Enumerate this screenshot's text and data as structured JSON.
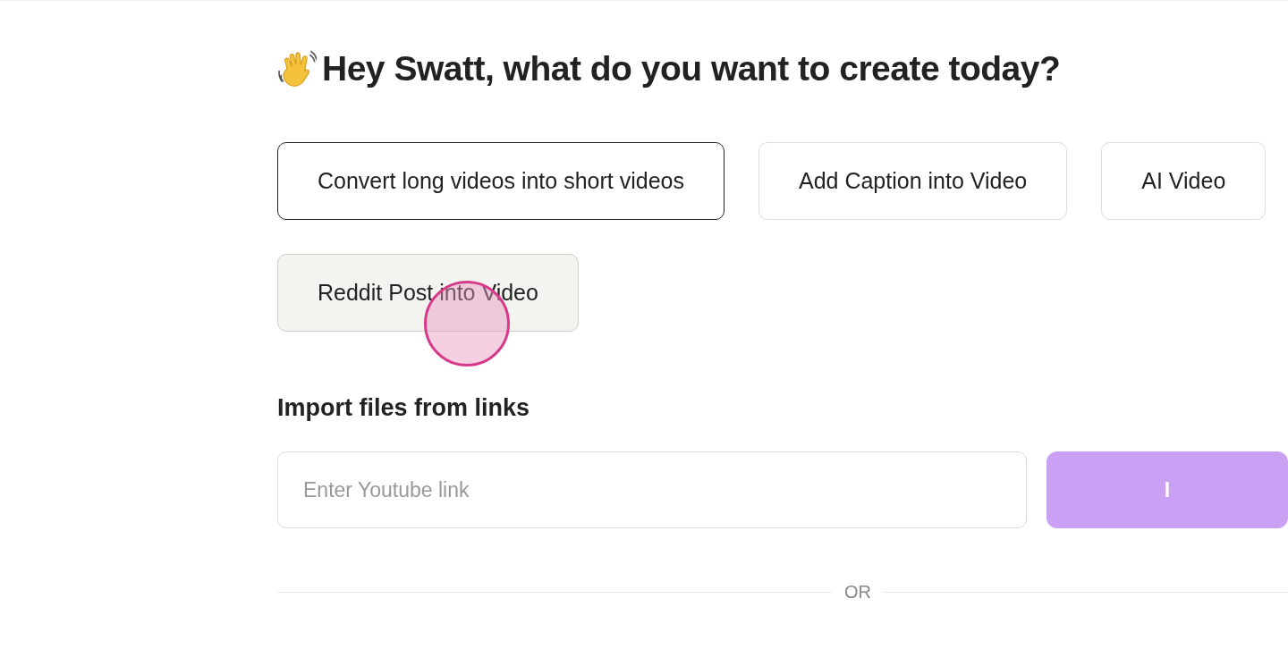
{
  "heading": "Hey Swatt, what do you want to create today?",
  "options": [
    {
      "label": "Convert long videos into short videos",
      "selected": true,
      "hovered": false
    },
    {
      "label": "Add Caption into Video",
      "selected": false,
      "hovered": false
    },
    {
      "label": "AI Video",
      "selected": false,
      "hovered": false
    },
    {
      "label": "Reddit Post into Video",
      "selected": false,
      "hovered": true
    }
  ],
  "import": {
    "title": "Import files from links",
    "placeholder": "Enter Youtube link",
    "button": "I"
  },
  "divider": "OR"
}
